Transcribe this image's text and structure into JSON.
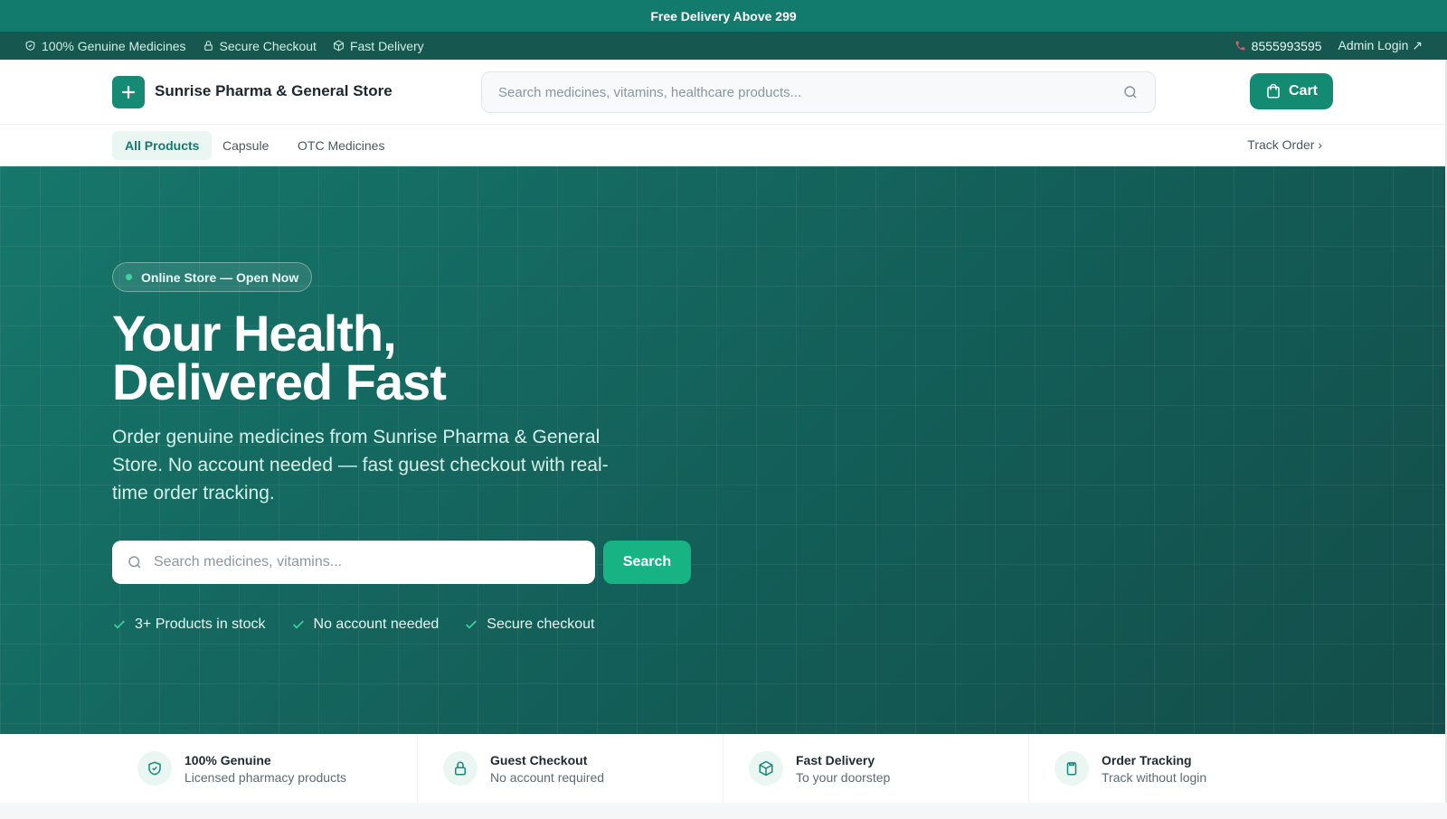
{
  "announcement": "Free Delivery Above 299",
  "topbar": {
    "badges": [
      "100% Genuine Medicines",
      "Secure Checkout",
      "Fast Delivery"
    ],
    "phone": "8555993595",
    "admin_login": "Admin Login ↗"
  },
  "header": {
    "store_name": "Sunrise Pharma & General Store",
    "search_placeholder": "Search medicines, vitamins, healthcare products...",
    "cart_label": "Cart"
  },
  "nav": {
    "categories": [
      "All Products",
      "Capsule",
      "OTC Medicines"
    ],
    "active": "All Products",
    "track_order": "Track Order ›"
  },
  "hero": {
    "badge": "Online Store — Open Now",
    "title_line1": "Your Health,",
    "title_line2": "Delivered Fast",
    "subtitle": "Order genuine medicines from Sunrise Pharma & General Store. No account needed — fast guest checkout with real-time order tracking.",
    "search_placeholder": "Search medicines, vitamins...",
    "search_button": "Search",
    "checks": [
      "3+ Products in stock",
      "No account needed",
      "Secure checkout"
    ]
  },
  "features": [
    {
      "title": "100% Genuine",
      "desc": "Licensed pharmacy products",
      "icon": "shield-icon"
    },
    {
      "title": "Guest Checkout",
      "desc": "No account required",
      "icon": "lock-icon"
    },
    {
      "title": "Fast Delivery",
      "desc": "To your doorstep",
      "icon": "box-icon"
    },
    {
      "title": "Order Tracking",
      "desc": "Track without login",
      "icon": "clipboard-icon"
    }
  ],
  "colors": {
    "primary": "#137a6e",
    "accent": "#17b383",
    "dark": "#16574f"
  }
}
